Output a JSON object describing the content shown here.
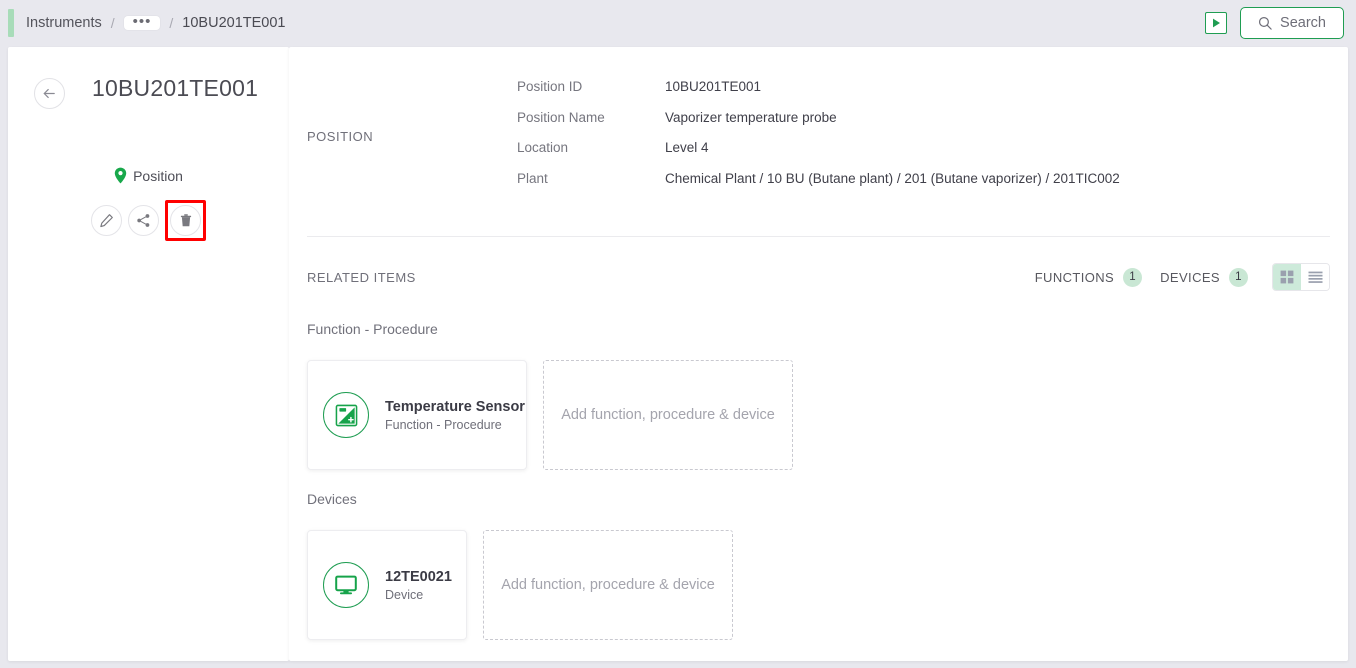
{
  "topbar": {
    "breadcrumb": {
      "root": "Instruments",
      "sep1": "/",
      "ellipsis": "•••",
      "sep2": "/",
      "current": "10BU201TE001"
    },
    "play_icon": "play-icon",
    "search_label": "Search",
    "search_icon": "search-icon"
  },
  "sidebar": {
    "back_icon": "arrow-left-icon",
    "title": "10BU201TE001",
    "type_icon": "map-pin-icon",
    "type_label": "Position",
    "actions": [
      {
        "name": "edit",
        "icon": "pencil-icon"
      },
      {
        "name": "share",
        "icon": "share-icon"
      },
      {
        "name": "delete",
        "icon": "trash-icon",
        "highlighted": true
      }
    ]
  },
  "position": {
    "section_label": "POSITION",
    "fields": [
      {
        "label": "Position ID",
        "value": "10BU201TE001"
      },
      {
        "label": "Position Name",
        "value": "Vaporizer temperature probe"
      },
      {
        "label": "Location",
        "value": "Level 4"
      },
      {
        "label": "Plant",
        "value": "Chemical Plant / 10 BU (Butane plant) / 201 (Butane vaporizer) / 201TIC002"
      }
    ]
  },
  "related_items": {
    "section_label": "RELATED ITEMS",
    "tabs": [
      {
        "label": "FUNCTIONS",
        "count": "1"
      },
      {
        "label": "DEVICES",
        "count": "1"
      }
    ],
    "view_grid_icon": "grid-view-icon",
    "view_list_icon": "list-view-icon",
    "groups": [
      {
        "title": "Function - Procedure",
        "cards": [
          {
            "title": "Temperature Sensor",
            "subtitle": "Function - Procedure",
            "icon": "function-procedure-icon"
          }
        ],
        "add_label": "Add function, procedure & device"
      },
      {
        "title": "Devices",
        "cards": [
          {
            "title": "12TE0021",
            "subtitle": "Device",
            "icon": "monitor-icon"
          }
        ],
        "add_label": "Add function, procedure & device"
      }
    ]
  },
  "colors": {
    "accent_green": "#1f9d52",
    "badge_green": "#c9e7d4",
    "highlight_red": "#ff0000",
    "page_bg": "#e8e8ee"
  }
}
